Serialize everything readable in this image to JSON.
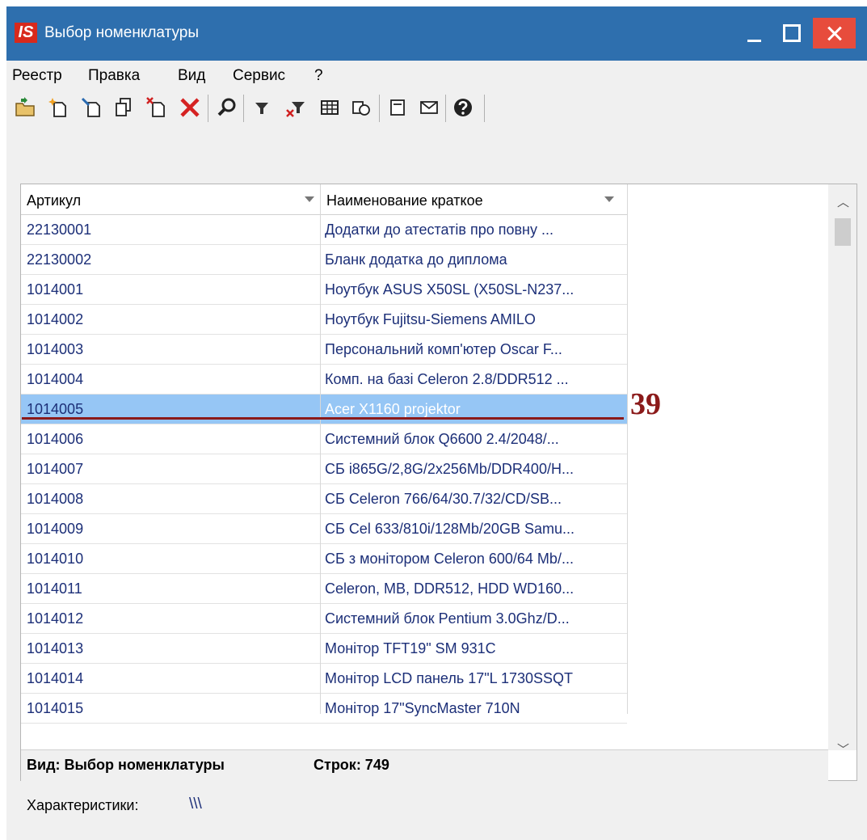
{
  "window": {
    "title": "Выбор номенклатуры",
    "logo": "IS",
    "controls": {
      "minimize": "minimize-icon",
      "maximize": "maximize-icon",
      "close": "close-icon"
    }
  },
  "menu": [
    "Реестр",
    "Правка",
    "Вид",
    "Сервис",
    "?"
  ],
  "toolbar": {
    "icons": [
      "open-folder-icon",
      "new-document-icon",
      "edit-document-icon",
      "copy-document-icon",
      "delete-document-icon",
      "delete-icon",
      "search-icon",
      "filter-icon",
      "clear-filter-icon",
      "table-icon",
      "refresh-icon",
      "form-icon",
      "mail-icon",
      "help-icon"
    ]
  },
  "grid": {
    "columns": [
      "Артикул",
      "Наименование краткое"
    ],
    "rows": [
      [
        "22130001",
        "Додатки до атестатів про повну ..."
      ],
      [
        "22130002",
        "Бланк додатка до диплома"
      ],
      [
        "1014001",
        "Ноутбук ASUS X50SL (X50SL-N237..."
      ],
      [
        "1014002",
        "Ноутбук Fujitsu-Siemens AMILO"
      ],
      [
        "1014003",
        "Персональний комп'ютер Oscar F..."
      ],
      [
        "1014004",
        "Комп. на базі Celeron 2.8/DDR512 ..."
      ],
      [
        "1014005",
        "Acer X1160 projektor"
      ],
      [
        "1014006",
        "Системний блок Q6600 2.4/2048/..."
      ],
      [
        "1014007",
        "СБ i865G/2,8G/2x256Mb/DDR400/H..."
      ],
      [
        "1014008",
        "СБ Celeron 766/64/30.7/32/CD/SB..."
      ],
      [
        "1014009",
        "СБ Cel 633/810i/128Mb/20GB Samu..."
      ],
      [
        "1014010",
        "СБ з монітором Celeron 600/64 Mb/..."
      ],
      [
        "1014011",
        "Celeron, MB, DDR512, HDD WD160..."
      ],
      [
        "1014012",
        "Системний блок Pentium 3.0Ghz/D..."
      ],
      [
        "1014013",
        "Монітор TFT19\" SM 931C"
      ],
      [
        "1014014",
        "Монітор LCD панель 17\"L 1730SSQT"
      ],
      [
        "1014015",
        "Монітор 17\"SyncMaster 710N"
      ]
    ],
    "selected_index": 6
  },
  "status": {
    "view": "Вид: Выбор номенклатуры",
    "rows": "Строк: 749"
  },
  "characteristics": {
    "label": "Характеристики:",
    "value": "\\\\\\"
  },
  "annotation": {
    "number": "39",
    "color": "#8b1a1a"
  },
  "colors": {
    "titlebar": "#2e6fae",
    "selection": "#96c6f5",
    "close": "#e74c3c",
    "logo": "#d8291c",
    "row_text": "#1c2f78"
  }
}
